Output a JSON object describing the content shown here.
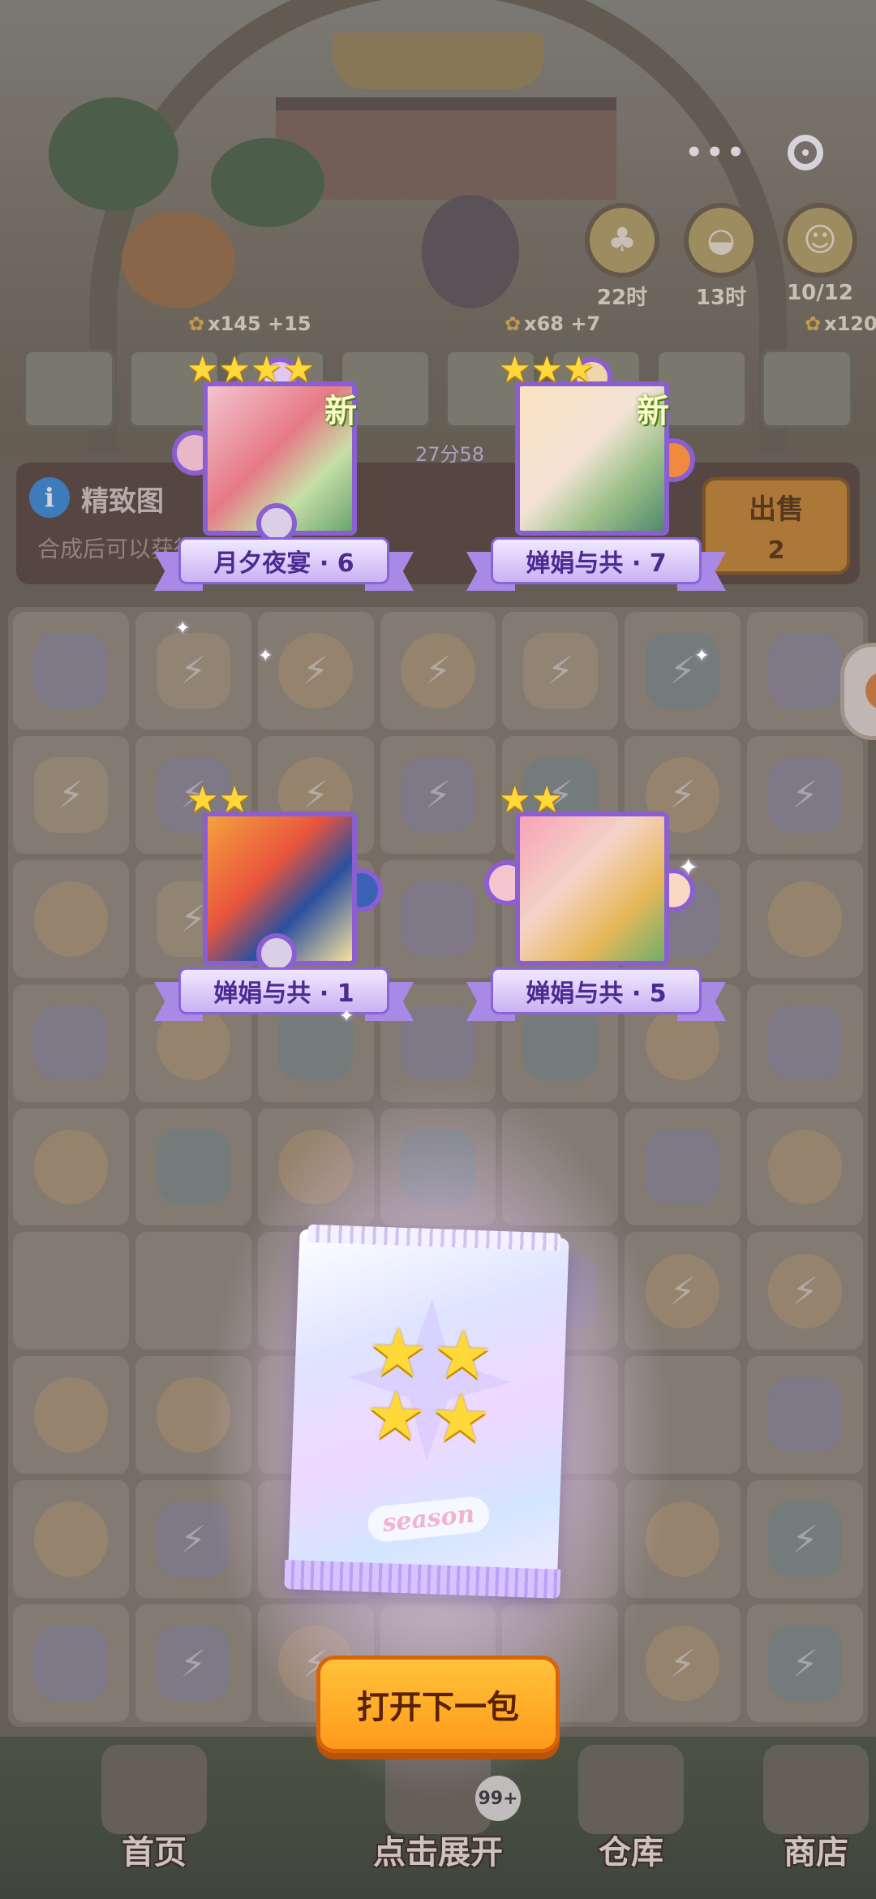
{
  "topbar": {
    "menu_dots": "•••",
    "record_icon": "record-icon"
  },
  "timers": [
    {
      "label": "22时",
      "icon": "clover-icon"
    },
    {
      "label": "13时",
      "icon": "pot-icon"
    },
    {
      "label": "10/12",
      "icon": "sunflower-icon"
    }
  ],
  "rewards": [
    {
      "text": "x145 +15"
    },
    {
      "text": "x68 +7"
    },
    {
      "text": "x120"
    }
  ],
  "info": {
    "title": "精致图",
    "description": "合成后可以获得…到。",
    "countdown": "27分58"
  },
  "sell": {
    "label": "出售",
    "count": "2"
  },
  "cards": [
    {
      "name": "月夕夜宴 · 6",
      "stars": "★★★★",
      "new": "新"
    },
    {
      "name": "婵娟与共 · 7",
      "stars": "★★★",
      "new": "新"
    },
    {
      "name": "婵娟与共 · 1",
      "stars": "★★",
      "new": ""
    },
    {
      "name": "婵娟与共 · 5",
      "stars": "★★",
      "new": ""
    }
  ],
  "pack": {
    "label": "season",
    "stars": [
      "★",
      "★",
      "★",
      "★"
    ]
  },
  "open_button": {
    "label": "打开下一包"
  },
  "nav": {
    "home": "首页",
    "expand": "点击展开",
    "expand_badge": "99+",
    "warehouse": "仓库",
    "shop": "商店"
  },
  "colors": {
    "accent_purple": "#8b5fd1",
    "star_yellow": "#ffd83a",
    "button_orange": "#ff9a1a"
  }
}
